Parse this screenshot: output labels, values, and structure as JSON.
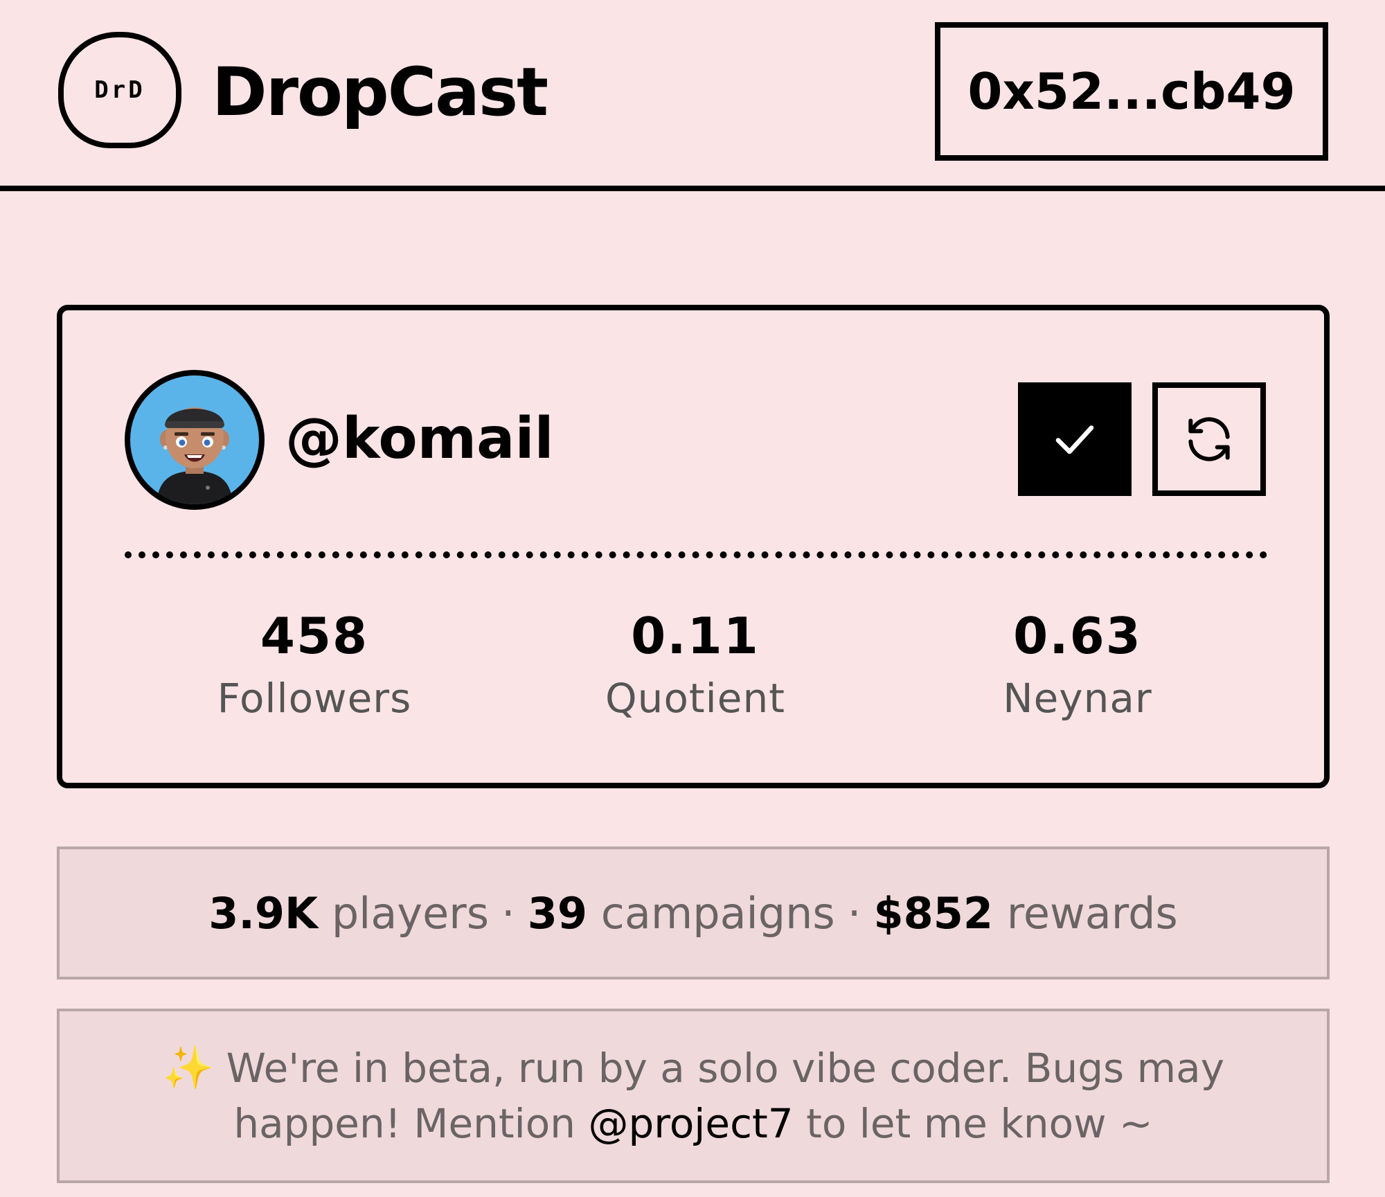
{
  "header": {
    "logo_badge": "DrD",
    "brand": "DropCast",
    "wallet": "0x52...cb49"
  },
  "profile": {
    "username": "@komail",
    "avatar": "3d-avatar-illustration",
    "verified_icon": "check-icon",
    "refresh_icon": "refresh-icon",
    "stats": [
      {
        "value": "458",
        "label": "Followers"
      },
      {
        "value": "0.11",
        "label": "Quotient"
      },
      {
        "value": "0.63",
        "label": "Neynar"
      }
    ]
  },
  "summary": {
    "players_value": "3.9K",
    "players_label": "players",
    "campaigns_value": "39",
    "campaigns_label": "campaigns",
    "rewards_value": "$852",
    "rewards_label": "rewards",
    "separator": "·"
  },
  "beta_notice": {
    "sparkle": "✨",
    "line1": "We're in beta, run by a solo vibe coder. Bugs may",
    "line2_start": "happen! Mention ",
    "mention": "@project7",
    "line2_end": " to let me know ~"
  },
  "colors": {
    "background": "#fbe4e6",
    "panel": "#f0d9db",
    "avatar_bg": "#5ab4ea",
    "muted_text": "#6a6465"
  }
}
